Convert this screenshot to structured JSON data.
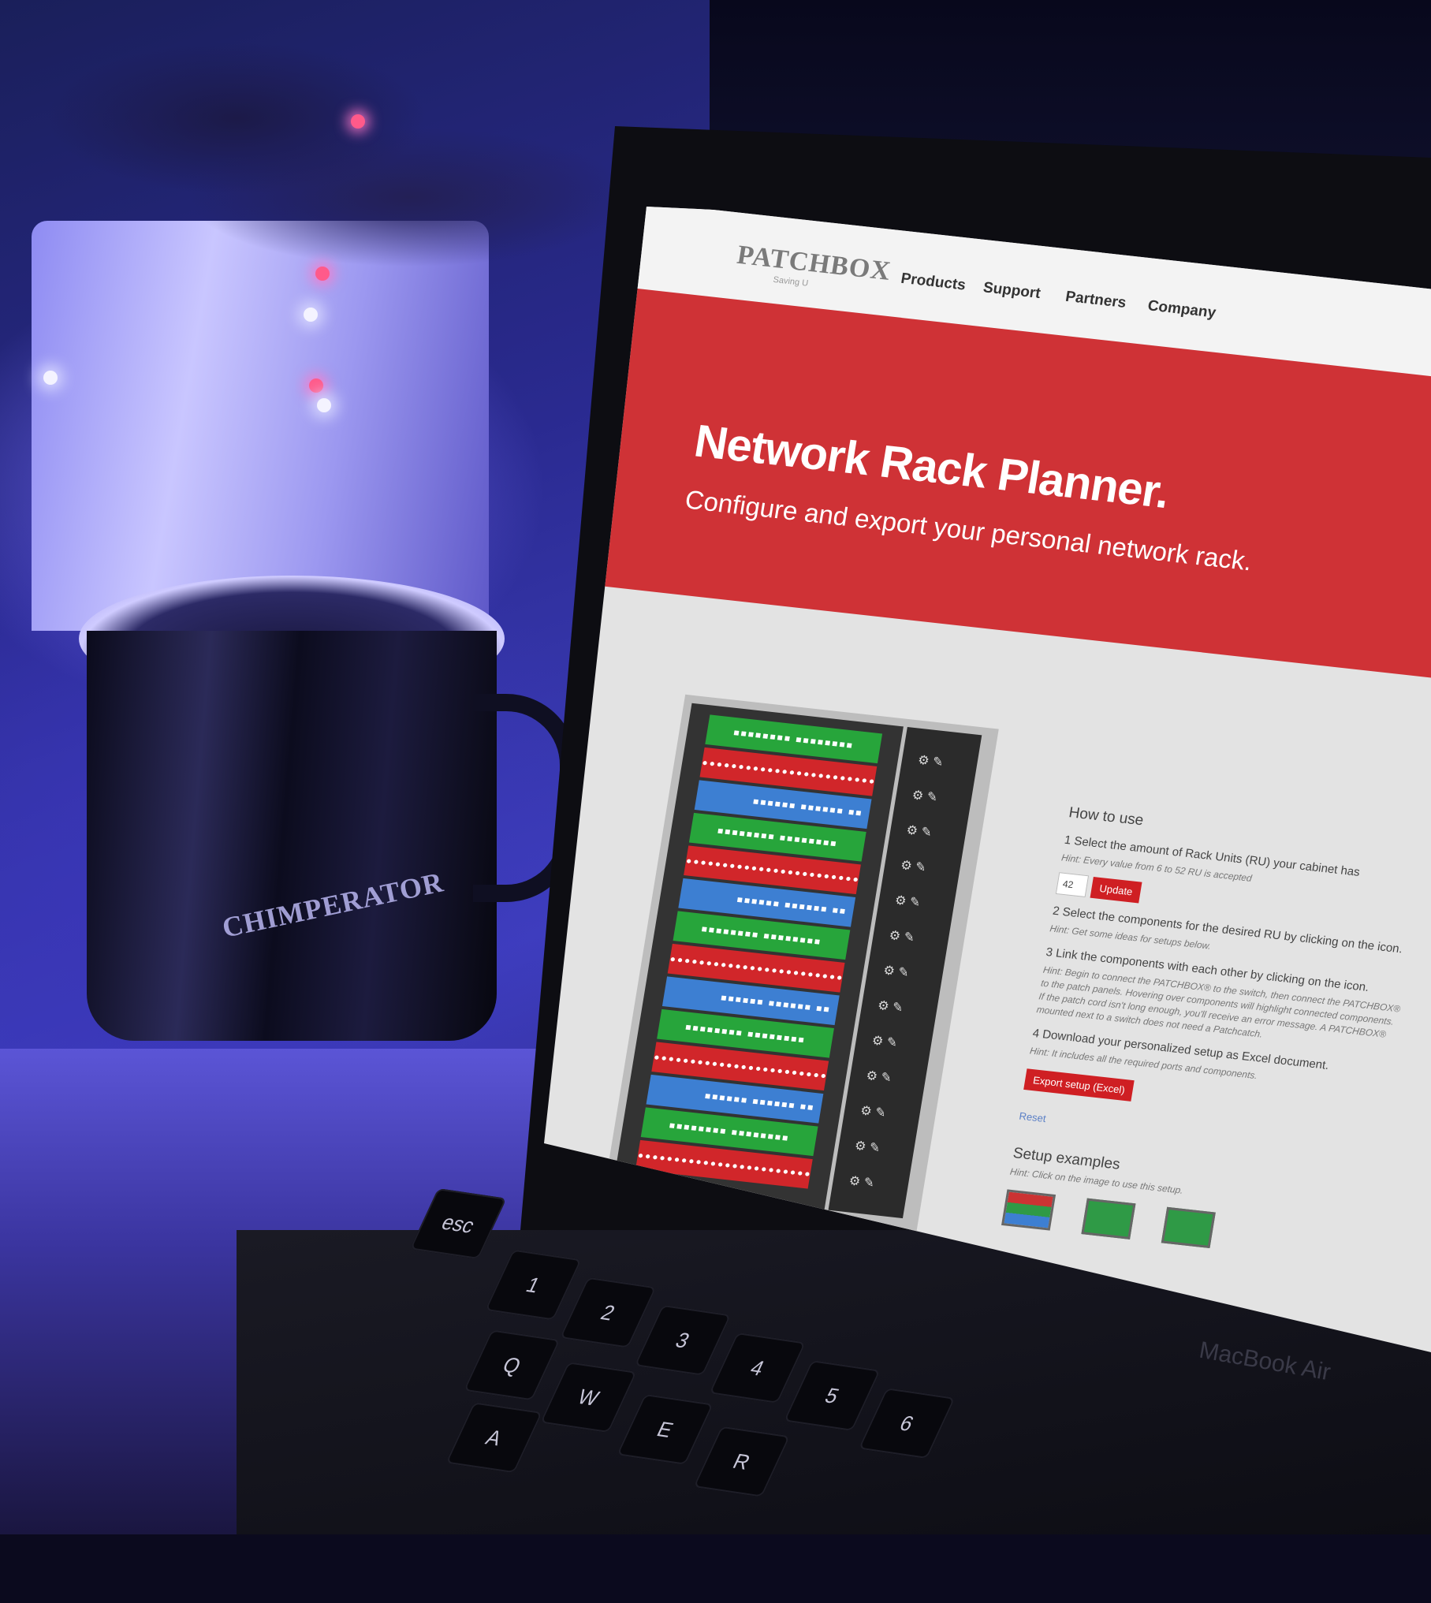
{
  "site": {
    "logo": "PATCHBOX",
    "logo_tagline": "Saving U"
  },
  "nav": {
    "items": [
      "Products",
      "Support",
      "Partners",
      "Company"
    ]
  },
  "hero": {
    "title": "Network Rack Planner.",
    "subtitle": "Configure and export your personal network rack."
  },
  "howto": {
    "heading": "How to use",
    "step1": "1 Select the amount of Rack Units (RU) your cabinet has",
    "step1_hint": "Hint: Every value from 6 to 52 RU is accepted",
    "ru_value": "42",
    "update_label": "Update",
    "step2": "2 Select the components for the desired RU by clicking on the icon.",
    "step2_hint": "Hint: Get some ideas for setups below.",
    "step3": "3 Link the components with each other by clicking on the icon.",
    "step3_hint": "Hint: Begin to connect the PATCHBOX® to the switch, then connect the PATCHBOX® to the patch panels. Hovering over components will highlight connected components. If the patch cord isn't long enough, you'll receive an error message. A PATCHBOX® mounted next to a switch does not need a Patchcatch.",
    "step4": "4 Download your personalized setup as Excel document.",
    "step4_hint": "Hint: It includes all the required ports and components.",
    "export_label": "Export setup (Excel)",
    "reset_label": "Reset",
    "setup_title": "Setup examples",
    "setup_hint": "Hint: Click on the image to use this setup."
  },
  "mug": {
    "logo": "CHIMPERATOR"
  },
  "keyboard": {
    "keys": [
      "esc",
      "1",
      "2",
      "3",
      "4",
      "5",
      "6",
      "Q",
      "W",
      "E",
      "R",
      "A"
    ],
    "brand": "MacBook Air"
  },
  "colors": {
    "brand_red": "#cf3236",
    "rack_green": "#27a53b",
    "rack_red": "#d1262a",
    "rack_blue": "#3d7fd2"
  }
}
